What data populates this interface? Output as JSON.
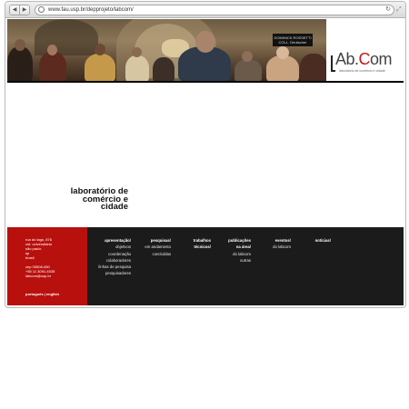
{
  "browser": {
    "url": "www.fau.usp.br/depprojeto/labcom/",
    "back_glyph": "◀",
    "forward_glyph": "▶",
    "reload_glyph": "↻",
    "resize_glyph": "⤢"
  },
  "banner": {
    "sign_text": "DOMINICK ROSSETTI COLL. Deutscher",
    "logo_prefix": "Ab.",
    "logo_c": "C",
    "logo_suffix": "om",
    "logo_subtitle": "laboratório de comércio e cidade"
  },
  "title": {
    "line1": "laboratório de",
    "line2": "comércio e",
    "line3": "cidade"
  },
  "footer": {
    "address": [
      "rua do lago, 876",
      "cid. universitária",
      "são paulo",
      "sp",
      "brasil"
    ],
    "contact": [
      "cep 05508-080",
      "+55 11 3091-4535",
      "labcom@usp.br"
    ],
    "language": "português | english",
    "menu": {
      "apresentacao": {
        "heading": "apresentação/",
        "items": [
          "objetivos",
          "coordenação",
          "colaboradores",
          "linhas de pesquisa",
          "pesquisadores"
        ]
      },
      "pesquisas": {
        "heading": "pesquisas/",
        "items": [
          "em andamento",
          "concluídas"
        ]
      },
      "trabalhos": {
        "heading": "trabalhos",
        "items": [
          "técnicos/"
        ]
      },
      "publicacoes": {
        "heading": "publicações",
        "items": [
          "na área/",
          "do labcom",
          "outras"
        ]
      },
      "eventos": {
        "heading": "eventos/",
        "items": [
          "do labcom"
        ]
      },
      "noticias": {
        "heading": "notícias/",
        "items": []
      }
    }
  },
  "colors": {
    "footer_bg": "#1b1b1b",
    "red_panel": "#b8110d",
    "logo_accent": "#c41a1a"
  }
}
